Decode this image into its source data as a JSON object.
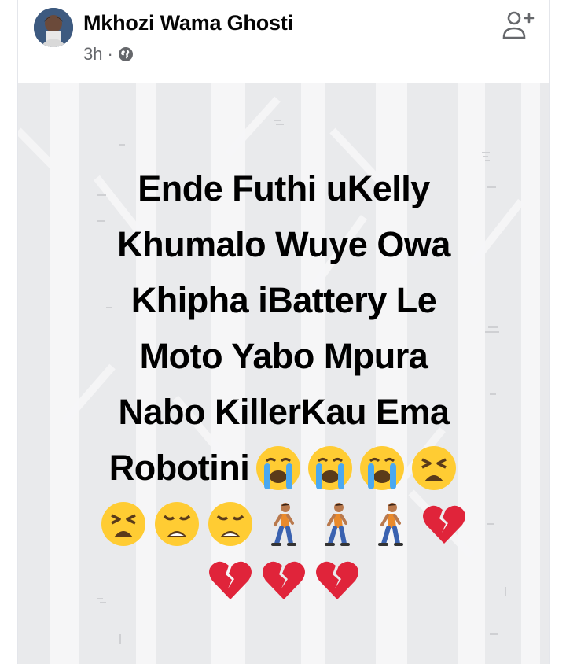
{
  "post": {
    "author": "Mkhozi Wama Ghosti",
    "time": "3h",
    "separator": "·",
    "privacy_icon": "globe-icon",
    "action_icon": "add-friend-icon",
    "text_lines": [
      "Ende Futhi uKelly",
      "Khumalo Wuye Owa",
      "Khipha iBattery Le",
      "Moto Yabo Mpura",
      "Nabo KillerKau Ema",
      "Robotini"
    ],
    "emoji_groups": {
      "line6_trailing": [
        "loudly-crying-face",
        "loudly-crying-face",
        "loudly-crying-face",
        "tired-face"
      ],
      "line7": [
        "tired-face",
        "weary-face",
        "weary-face",
        "person-walking",
        "person-walking",
        "person-walking",
        "broken-heart"
      ],
      "line8": [
        "broken-heart",
        "broken-heart",
        "broken-heart"
      ]
    },
    "colors": {
      "author_text": "#050505",
      "meta_text": "#65676b",
      "post_background": "#e9eaec",
      "post_text": "#000000",
      "emoji_yellow": "#ffcc33",
      "heart_red": "#e0243a"
    }
  }
}
